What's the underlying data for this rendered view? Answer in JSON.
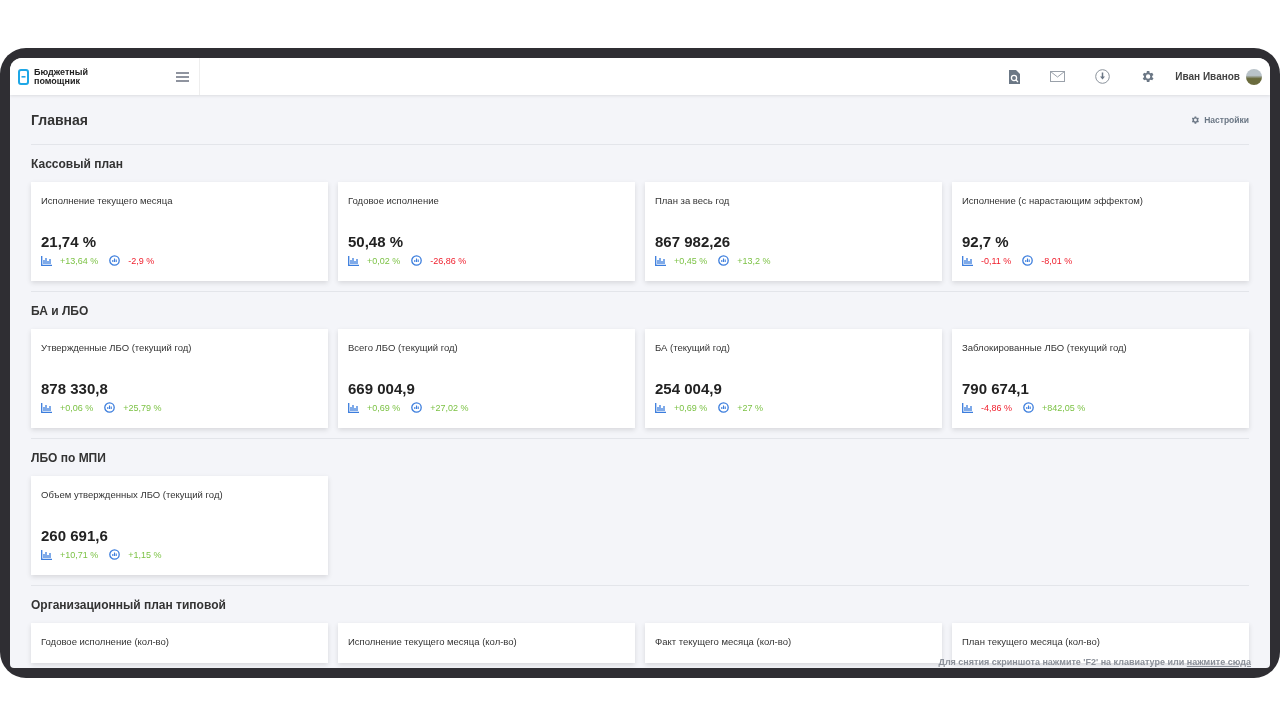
{
  "header": {
    "logo": "Бюджетный помощник",
    "user": "Иван Иванов"
  },
  "page": {
    "title": "Главная",
    "settings": "Настройки"
  },
  "sections": [
    {
      "title": "Кассовый план",
      "cards": [
        {
          "label": "Исполнение текущего месяца",
          "value": "21,74 %",
          "deltas": [
            {
              "kind": "bars",
              "text": "+13,64 %",
              "negative": false
            },
            {
              "kind": "circle",
              "text": "-2,9 %",
              "negative": true
            }
          ]
        },
        {
          "label": "Годовое исполнение",
          "value": "50,48 %",
          "deltas": [
            {
              "kind": "bars",
              "text": "+0,02 %",
              "negative": false
            },
            {
              "kind": "circle",
              "text": "-26,86 %",
              "negative": true
            }
          ]
        },
        {
          "label": "План за весь год",
          "value": "867 982,26",
          "deltas": [
            {
              "kind": "bars",
              "text": "+0,45 %",
              "negative": false
            },
            {
              "kind": "circle",
              "text": "+13,2 %",
              "negative": false
            }
          ]
        },
        {
          "label": "Исполнение (с нарастающим эффектом)",
          "value": "92,7 %",
          "deltas": [
            {
              "kind": "bars",
              "text": "-0,11 %",
              "negative": true
            },
            {
              "kind": "circle",
              "text": "-8,01 %",
              "negative": true
            }
          ]
        }
      ]
    },
    {
      "title": "БА и ЛБО",
      "cards": [
        {
          "label": "Утвержденные ЛБО (текущий год)",
          "value": "878 330,8",
          "deltas": [
            {
              "kind": "bars",
              "text": "+0,06 %",
              "negative": false
            },
            {
              "kind": "circle",
              "text": "+25,79 %",
              "negative": false
            }
          ]
        },
        {
          "label": "Всего ЛБО (текущий год)",
          "value": "669 004,9",
          "deltas": [
            {
              "kind": "bars",
              "text": "+0,69 %",
              "negative": false
            },
            {
              "kind": "circle",
              "text": "+27,02 %",
              "negative": false
            }
          ]
        },
        {
          "label": "БА (текущий год)",
          "value": "254 004,9",
          "deltas": [
            {
              "kind": "bars",
              "text": "+0,69 %",
              "negative": false
            },
            {
              "kind": "circle",
              "text": "+27 %",
              "negative": false
            }
          ]
        },
        {
          "label": "Заблокированные ЛБО (текущий год)",
          "value": "790 674,1",
          "deltas": [
            {
              "kind": "bars",
              "text": "-4,86 %",
              "negative": true
            },
            {
              "kind": "circle",
              "text": "+842,05 %",
              "negative": false
            }
          ]
        }
      ]
    },
    {
      "title": "ЛБО по МПИ",
      "cards": [
        {
          "label": "Объем утвержденных ЛБО (текущий год)",
          "value": "260 691,6",
          "deltas": [
            {
              "kind": "bars",
              "text": "+10,71 %",
              "negative": false
            },
            {
              "kind": "circle",
              "text": "+1,15 %",
              "negative": false
            }
          ]
        }
      ]
    },
    {
      "title": "Организационный план типовой",
      "cards": [
        {
          "label": "Годовое исполнение (кол-во)"
        },
        {
          "label": "Исполнение текущего месяца (кол-во)"
        },
        {
          "label": "Факт текущего месяца (кол-во)"
        },
        {
          "label": "План текущего месяца (кол-во)"
        }
      ]
    }
  ],
  "hint": {
    "text": "Для снятия скриншота нажмите 'F2' на клавиатуре или",
    "link": "нажмите сюда"
  }
}
